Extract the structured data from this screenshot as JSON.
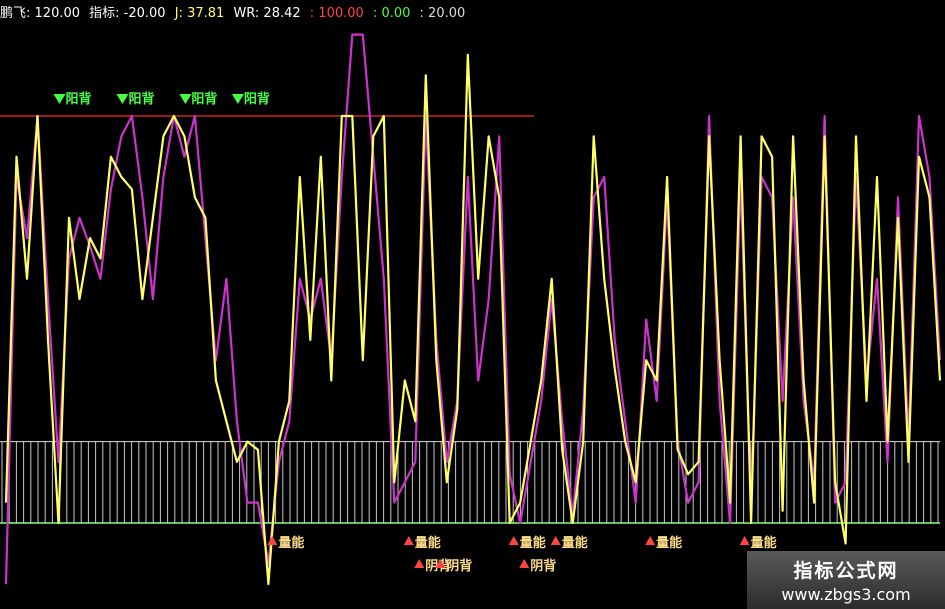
{
  "header": {
    "name": "鹏飞",
    "upper_text": ": 120.00",
    "indicator_label": "指标: ",
    "indicator_value": "-20.00",
    "j_text": "J: 37.81",
    "wr_text": "WR: 28.42",
    "level_100": ": 100.00",
    "level_0": ": 0.00",
    "level_20": ": 20.00"
  },
  "colors": {
    "j_line": "#ffff66",
    "wr_line": "#cc33cc",
    "upper_line": "#cc2222",
    "band": "#dddddd",
    "bottom_line": "#88ff88",
    "green_signal": "#44ff44",
    "red_signal": "#ff4444"
  },
  "chart_data": {
    "type": "line",
    "ylim": [
      -20,
      120
    ],
    "reference_lines": [
      100,
      20,
      0
    ],
    "x": [
      0,
      1,
      2,
      3,
      4,
      5,
      6,
      7,
      8,
      9,
      10,
      11,
      12,
      13,
      14,
      15,
      16,
      17,
      18,
      19,
      20,
      21,
      22,
      23,
      24,
      25,
      26,
      27,
      28,
      29,
      30,
      31,
      32,
      33,
      34,
      35,
      36,
      37,
      38,
      39,
      40,
      41,
      42,
      43,
      44,
      45,
      46,
      47,
      48,
      49,
      50,
      51,
      52,
      53,
      54,
      55,
      56,
      57,
      58,
      59,
      60,
      61,
      62,
      63,
      64,
      65,
      66,
      67,
      68,
      69,
      70,
      71,
      72,
      73,
      74,
      75,
      76,
      77,
      78,
      79,
      80,
      81,
      82,
      83,
      84,
      85,
      86,
      87,
      88,
      89
    ],
    "series": [
      {
        "name": "J",
        "values": [
          5,
          90,
          60,
          100,
          45,
          0,
          75,
          55,
          70,
          65,
          90,
          85,
          82,
          55,
          75,
          95,
          100,
          95,
          80,
          75,
          35,
          25,
          15,
          20,
          18,
          -15,
          20,
          30,
          85,
          45,
          90,
          35,
          100,
          100,
          40,
          95,
          100,
          10,
          35,
          25,
          110,
          40,
          10,
          28,
          115,
          60,
          95,
          80,
          0,
          5,
          20,
          35,
          60,
          18,
          0,
          20,
          95,
          60,
          38,
          20,
          10,
          40,
          35,
          85,
          18,
          12,
          15,
          95,
          40,
          5,
          95,
          0,
          95,
          90,
          3,
          95,
          35,
          5,
          95,
          10,
          -5,
          95,
          30,
          85,
          20,
          75,
          15,
          90,
          80,
          35
        ]
      },
      {
        "name": "WR",
        "values": [
          -15,
          85,
          70,
          100,
          55,
          15,
          65,
          75,
          68,
          60,
          82,
          95,
          100,
          80,
          55,
          85,
          100,
          90,
          100,
          70,
          40,
          60,
          25,
          5,
          5,
          -10,
          15,
          25,
          60,
          50,
          60,
          40,
          85,
          120,
          120,
          90,
          60,
          5,
          10,
          15,
          100,
          45,
          15,
          30,
          85,
          35,
          55,
          95,
          12,
          0,
          15,
          30,
          55,
          25,
          2,
          28,
          80,
          85,
          45,
          25,
          5,
          50,
          30,
          80,
          20,
          5,
          10,
          100,
          30,
          0,
          85,
          5,
          85,
          80,
          30,
          80,
          30,
          10,
          100,
          5,
          10,
          85,
          35,
          60,
          15,
          80,
          20,
          100,
          85,
          40
        ]
      }
    ]
  },
  "signals": {
    "green": [
      {
        "x": 3,
        "text": "阳背"
      },
      {
        "x": 9,
        "text": "阳背"
      },
      {
        "x": 15,
        "text": "阳背"
      },
      {
        "x": 20,
        "text": "阳背"
      }
    ],
    "red": [
      {
        "x": 25,
        "text": "量能"
      },
      {
        "x": 38,
        "text": "量能"
      },
      {
        "x": 39,
        "text": "阴背"
      },
      {
        "x": 41,
        "text": "阴背"
      },
      {
        "x": 48,
        "text": "量能"
      },
      {
        "x": 49,
        "text": "阴背"
      },
      {
        "x": 52,
        "text": "量能"
      },
      {
        "x": 61,
        "text": "量能"
      },
      {
        "x": 70,
        "text": "量能"
      }
    ]
  },
  "watermark": {
    "line1": "指标公式网",
    "line2": "www.zbgs3.com"
  }
}
